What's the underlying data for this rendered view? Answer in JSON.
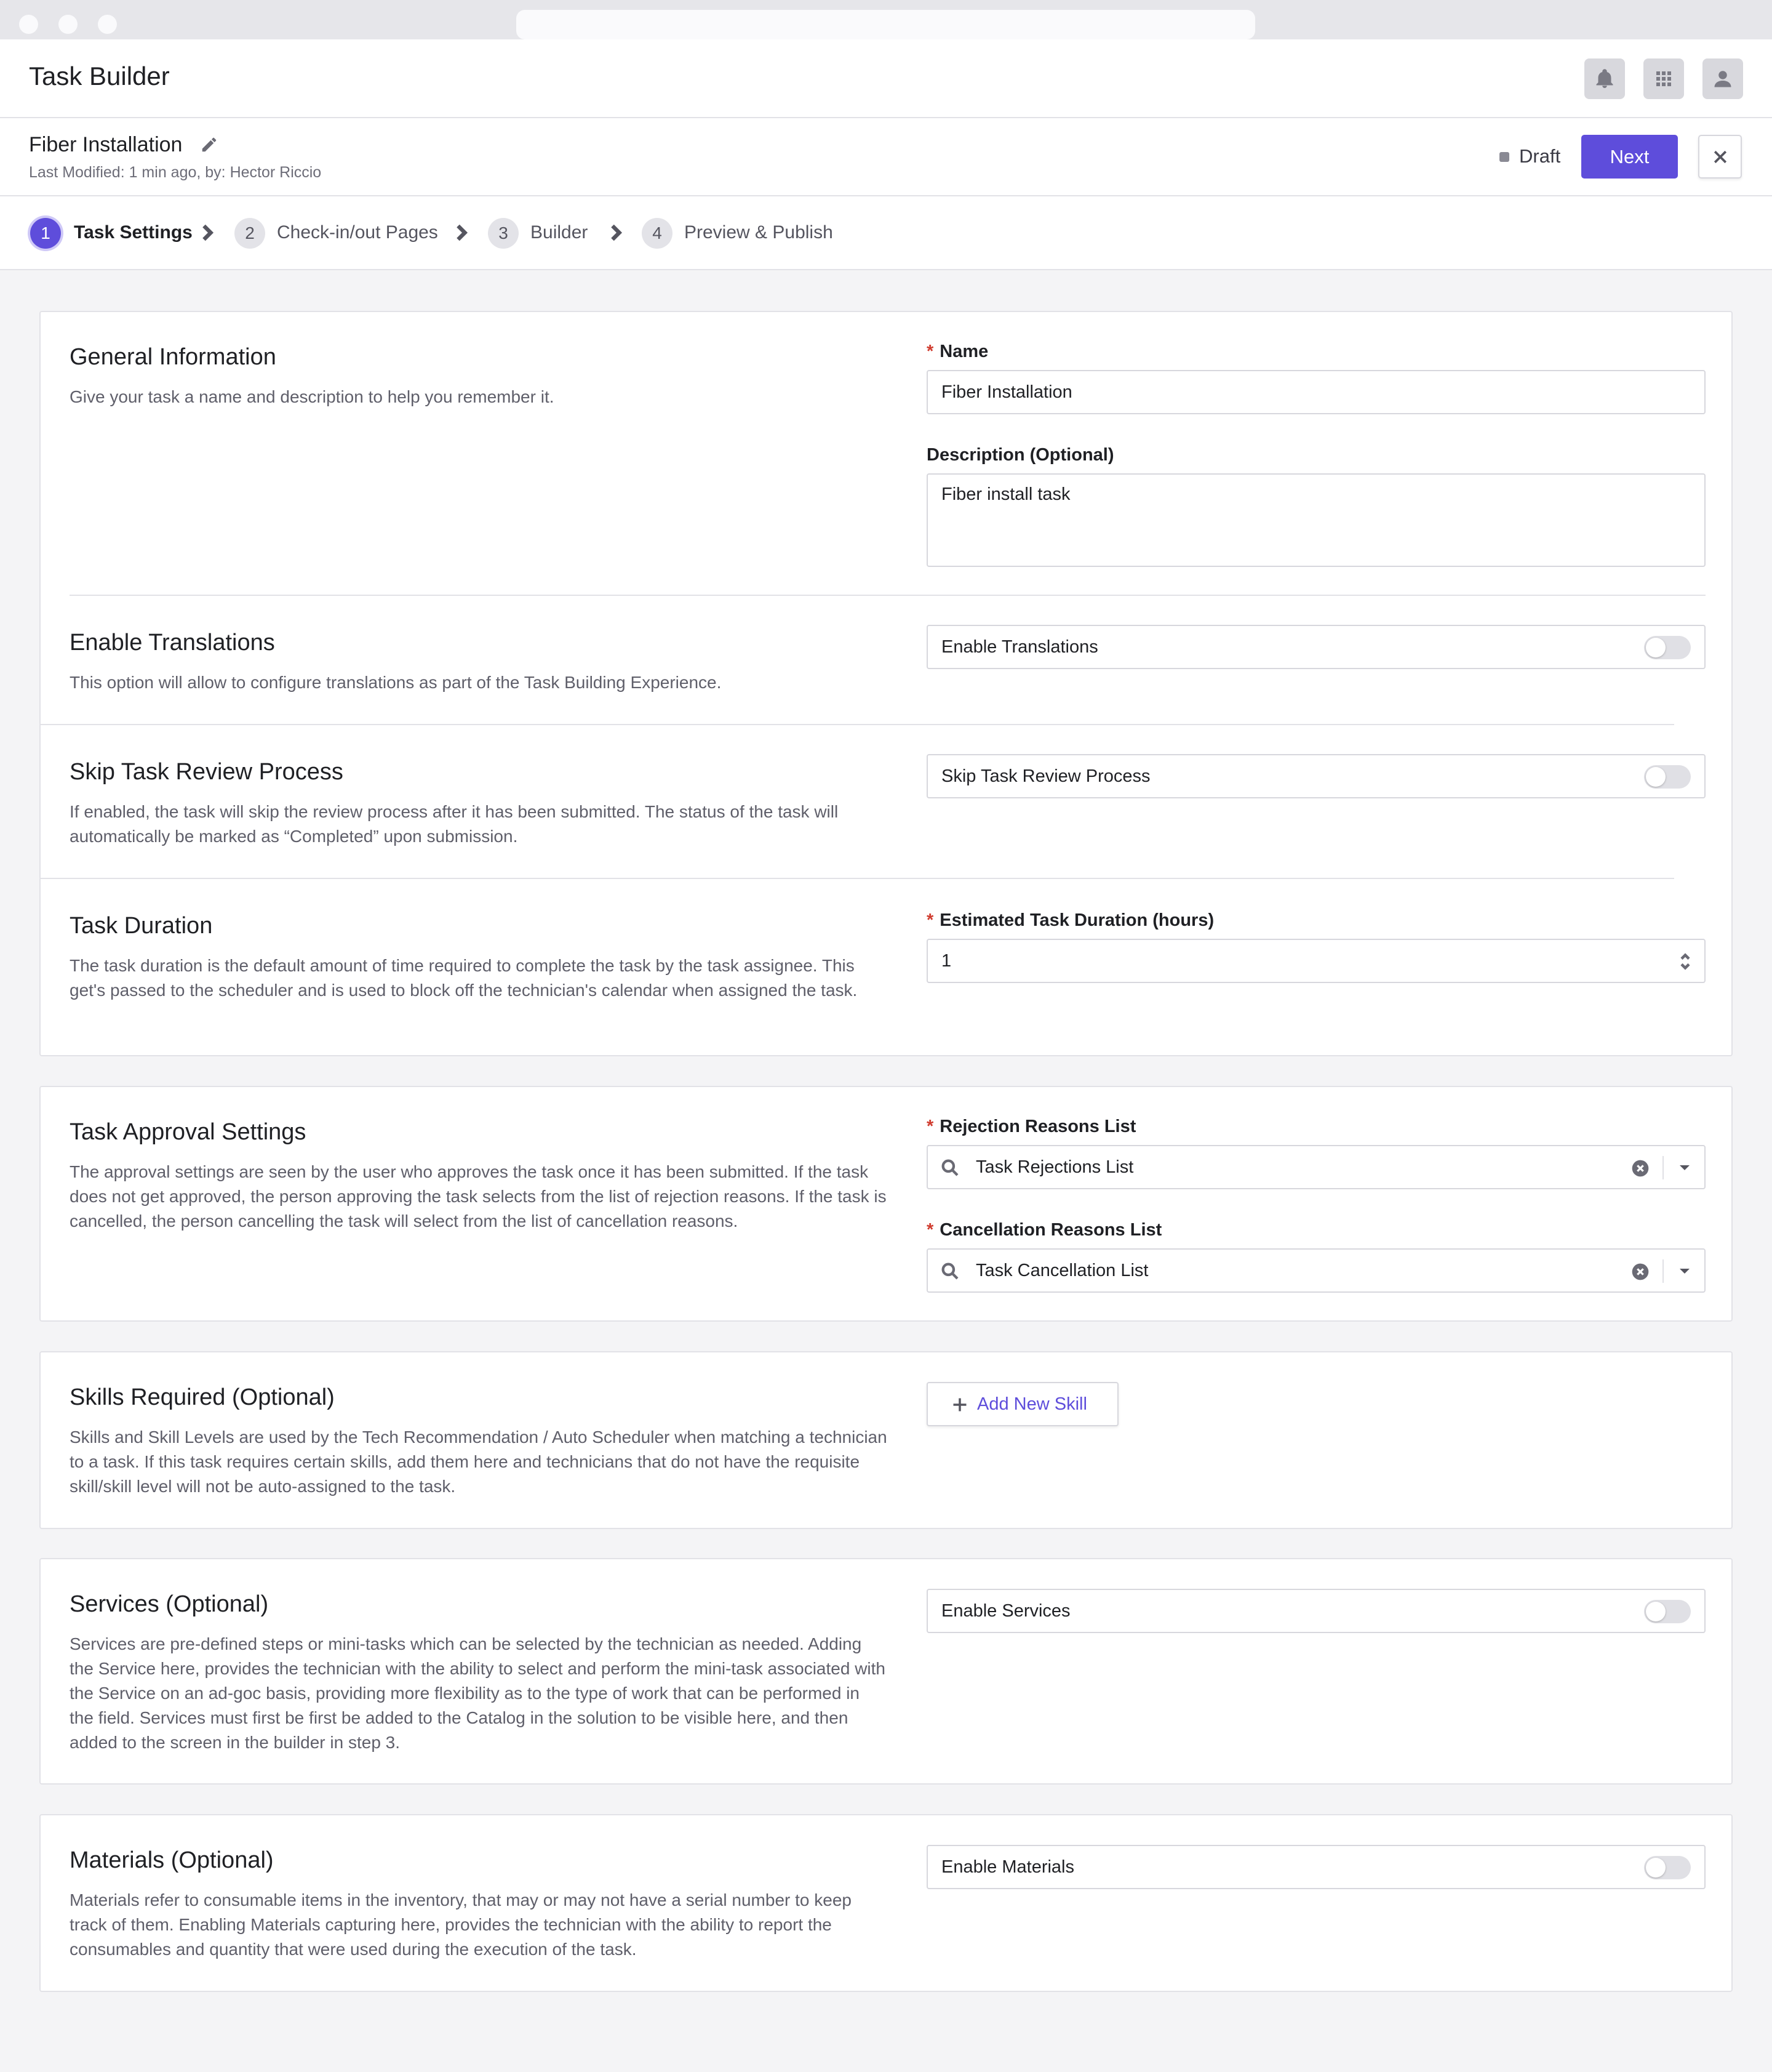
{
  "app": {
    "title": "Task Builder",
    "accent_color": "#5e4ddb",
    "header_icons": [
      "bell-icon",
      "apps-grid-icon",
      "user-icon"
    ]
  },
  "task": {
    "name": "Fiber Installation",
    "meta": "Last Modified: 1 min ago, by: Hector Riccio",
    "status": "Draft",
    "next_label": "Next"
  },
  "stepper": {
    "steps": [
      {
        "number": "1",
        "label": "Task Settings",
        "active": true
      },
      {
        "number": "2",
        "label": "Check-in/out Pages",
        "active": false
      },
      {
        "number": "3",
        "label": "Builder",
        "active": false
      },
      {
        "number": "4",
        "label": "Preview & Publish",
        "active": false
      }
    ]
  },
  "general": {
    "title": "General Information",
    "desc": "Give your task a name and description to help you remember it.",
    "name_label": "Name",
    "name_value": "Fiber Installation",
    "desc_label": "Description (Optional)",
    "desc_value": "Fiber install task"
  },
  "translations": {
    "title": "Enable Translations",
    "desc": "This option will allow to configure translations as part of the Task Building Experience.",
    "toggle_label": "Enable Translations",
    "enabled": false
  },
  "skip_review": {
    "title": "Skip Task Review Process",
    "desc": "If enabled, the task will skip the review process after it has been submitted. The status of the task will automatically be marked as “Completed” upon submission.",
    "toggle_label": "Skip Task Review Process",
    "enabled": false
  },
  "duration": {
    "title": "Task Duration",
    "desc": "The task duration is the default amount of time required to complete the task by the task assignee. This get's passed to the scheduler and is used to block off the technician's calendar when assigned the task.",
    "field_label": "Estimated Task Duration (hours)",
    "value": "1"
  },
  "approval": {
    "title": "Task Approval Settings",
    "desc": "The approval settings are seen by the user who approves the task once it has been submitted. If the task does not get approved, the person approving the task selects from the list of rejection reasons. If the task is cancelled, the person cancelling the task will select from the list of cancellation reasons.",
    "rejection_label": "Rejection Reasons List",
    "rejection_value": "Task Rejections List",
    "cancellation_label": "Cancellation Reasons List",
    "cancellation_value": "Task Cancellation List"
  },
  "skills": {
    "title": "Skills Required (Optional)",
    "desc": "Skills and Skill Levels are used by the Tech Recommendation / Auto Scheduler when matching a technician to a task. If this task requires certain skills, add them here and technicians that do not have the requisite skill/skill level will not be auto-assigned to the task.",
    "add_label": "Add New Skill"
  },
  "services": {
    "title": "Services (Optional)",
    "desc": "Services are pre-defined steps or mini-tasks which can be selected by the technician as needed. Adding the Service here, provides the technician with the ability to select and perform the mini-task associated with the Service on an ad-goc basis, providing more flexibility as to the type of work that can be performed in the field. Services must first be first be added to the Catalog in the solution to be visible here, and then added to the screen in the builder in step 3.",
    "toggle_label": "Enable Services",
    "enabled": false
  },
  "materials": {
    "title": "Materials (Optional)",
    "desc": "Materials refer to consumable items in the inventory, that may or may not have a serial number to keep track of them. Enabling Materials capturing here, provides the technician with the ability to report the consumables and quantity that were used during the execution of the task.",
    "toggle_label": "Enable Materials",
    "enabled": false
  }
}
